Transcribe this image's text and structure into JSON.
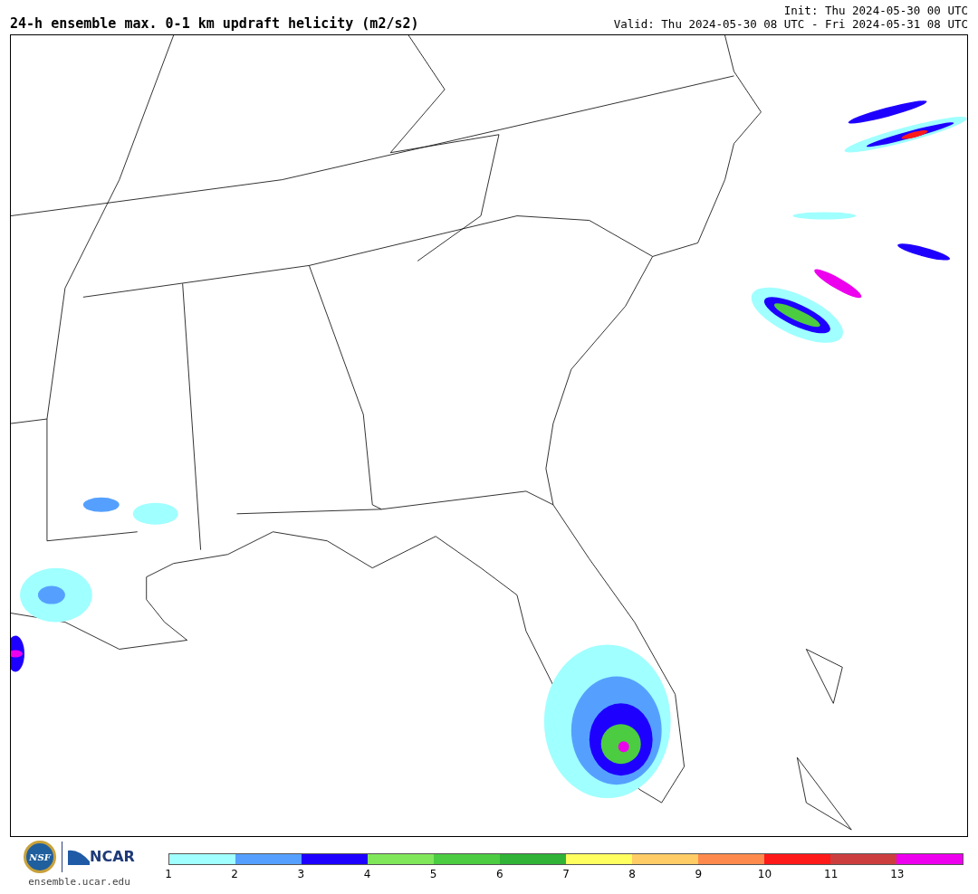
{
  "title": "24-h ensemble max. 0-1 km updraft helicity (m2/s2)",
  "init": "Init: Thu 2024-05-30 00 UTC",
  "valid": "Valid: Thu 2024-05-30 08 UTC - Fri 2024-05-31 08 UTC",
  "logos": {
    "nsf": "NSF",
    "ncar": "NCAR",
    "site": "ensemble.ucar.edu"
  },
  "colorbar": {
    "bins": [
      {
        "color": "#a0ffff"
      },
      {
        "color": "#55a0ff"
      },
      {
        "color": "#1e00ff"
      },
      {
        "color": "#80e65a"
      },
      {
        "color": "#4ccc41"
      },
      {
        "color": "#30b336"
      },
      {
        "color": "#ffff60"
      },
      {
        "color": "#ffcc66"
      },
      {
        "color": "#ff8a4d"
      },
      {
        "color": "#ff1a1a"
      },
      {
        "color": "#cc3e3e"
      },
      {
        "color": "#ed00ed"
      }
    ],
    "tick_labels": [
      "1",
      "2",
      "3",
      "4",
      "5",
      "6",
      "7",
      "8",
      "9",
      "10",
      "11",
      "13"
    ]
  }
}
